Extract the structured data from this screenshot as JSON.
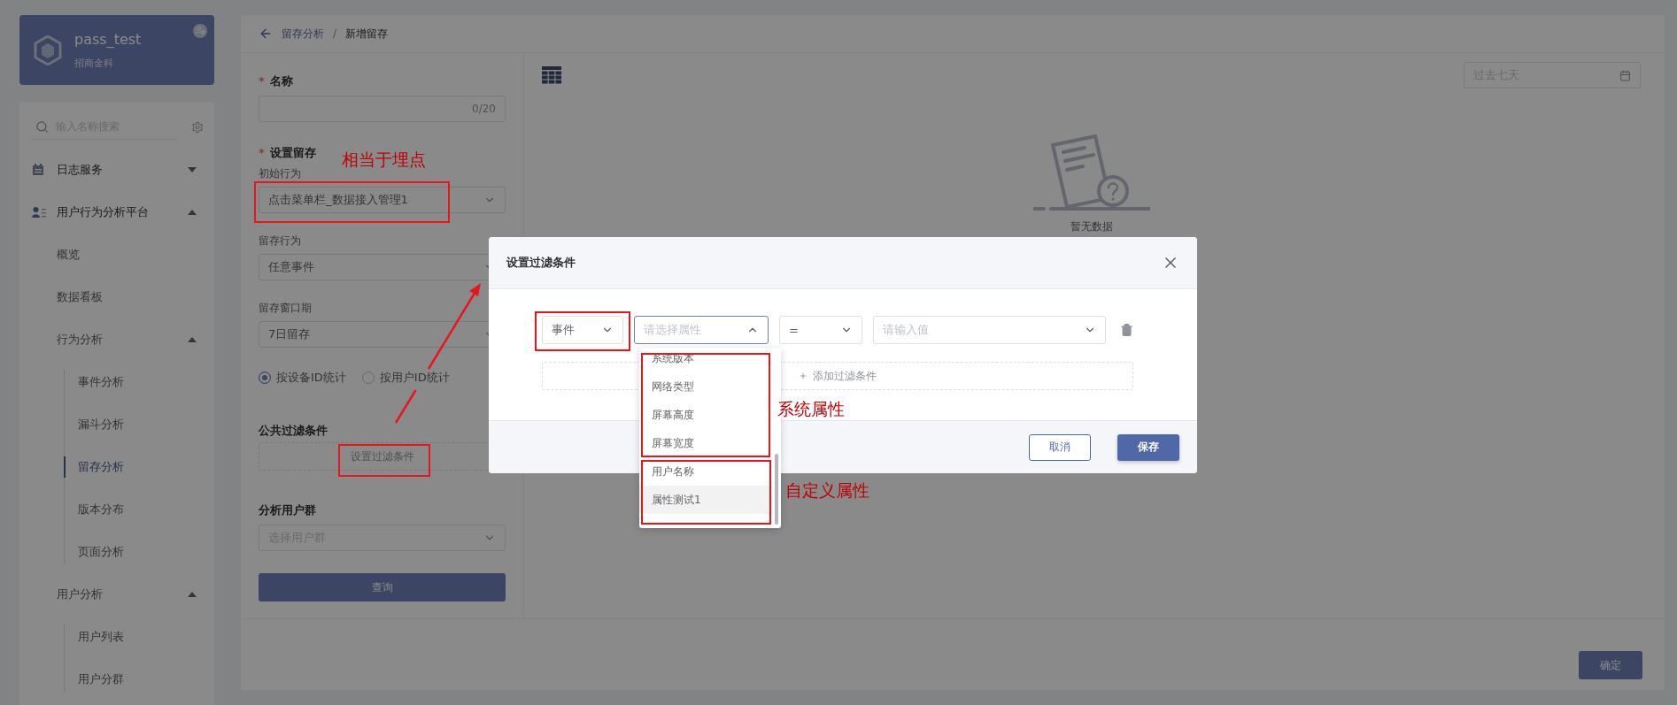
{
  "sidebar": {
    "app_name": "pass_test",
    "org": "招商金科",
    "search": {
      "placeholder": "输入名称搜索"
    },
    "menu": [
      {
        "label": "日志服务",
        "expanded": false,
        "selected": false
      },
      {
        "label": "用户行为分析平台",
        "expanded": true,
        "selected": false,
        "children": [
          {
            "label": "概览",
            "selected": false
          },
          {
            "label": "数据看板",
            "selected": false
          },
          {
            "label": "行为分析",
            "expanded": true,
            "selected": false,
            "children": [
              {
                "label": "事件分析",
                "selected": false
              },
              {
                "label": "漏斗分析",
                "selected": false
              },
              {
                "label": "留存分析",
                "selected": true
              },
              {
                "label": "版本分布",
                "selected": false
              },
              {
                "label": "页面分析",
                "selected": false
              }
            ]
          },
          {
            "label": "用户分析",
            "expanded": true,
            "selected": false,
            "children": [
              {
                "label": "用户列表",
                "selected": false
              },
              {
                "label": "用户分群",
                "selected": false
              }
            ]
          }
        ]
      }
    ]
  },
  "breadcrumb": {
    "items": [
      "留存分析",
      "新增留存"
    ],
    "separator": "/"
  },
  "form": {
    "name": {
      "required_mark": "*",
      "label": "名称",
      "counter": "0/20"
    },
    "retention": {
      "required_mark": "*",
      "label": "设置留存",
      "fields": [
        {
          "label": "初始行为",
          "value": "点击菜单栏_数据接入管理1"
        },
        {
          "label": "留存行为",
          "value": "任意事件"
        },
        {
          "label": "留存窗口期",
          "value": "7日留存"
        }
      ]
    },
    "stat_by": [
      {
        "label": "按设备ID统计",
        "selected": true
      },
      {
        "label": "按用户ID统计",
        "selected": false
      }
    ],
    "filter": {
      "label": "公共过滤条件",
      "button": "设置过滤条件"
    },
    "user_group": {
      "label": "分析用户群",
      "placeholder": "选择用户群"
    },
    "query_button": "查询"
  },
  "results": {
    "date_range": {
      "placeholder": "过去七天"
    },
    "empty_text": "暂无数据"
  },
  "footer": {
    "confirm_button": "确定"
  },
  "modal": {
    "title": "设置过滤条件",
    "condition": {
      "type_select": {
        "value": "事件"
      },
      "attribute_select": {
        "placeholder": "请选择属性",
        "expanded": true,
        "options": [
          {
            "label": "系统版本",
            "highlighted": false
          },
          {
            "label": "网络类型",
            "highlighted": false
          },
          {
            "label": "屏幕高度",
            "highlighted": false
          },
          {
            "label": "屏幕宽度",
            "highlighted": false
          },
          {
            "label": "用户名称",
            "highlighted": false
          },
          {
            "label": "属性测试1",
            "highlighted": true
          }
        ]
      },
      "operator_select": {
        "value": "="
      },
      "value_select": {
        "placeholder": "请输入值"
      }
    },
    "add_condition": "添加过滤条件",
    "buttons": [
      {
        "label": "取消",
        "kind": "secondary"
      },
      {
        "label": "保存",
        "kind": "primary"
      }
    ]
  },
  "annotations": [
    "相当于埋点",
    "系统属性",
    "自定义属性"
  ]
}
